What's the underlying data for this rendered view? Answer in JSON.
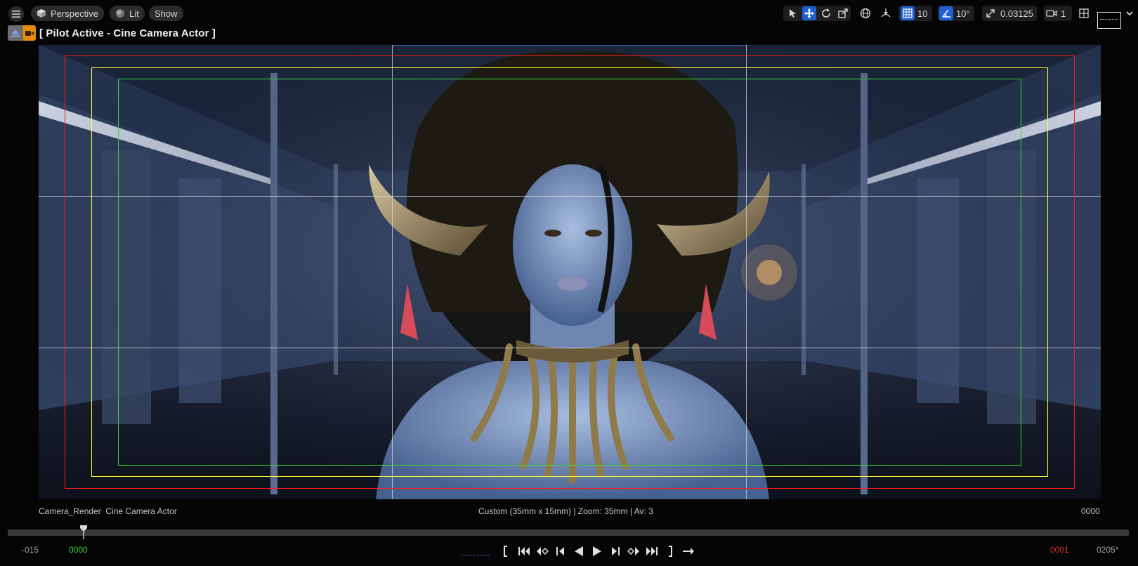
{
  "toolbar": {
    "viewport_type": "Perspective",
    "view_mode": "Lit",
    "show_label": "Show",
    "grid_snap_value": "10",
    "rotation_snap_value": "10°",
    "scale_snap_value": "0.03125",
    "camera_speed_value": "1",
    "accent_color": "#1f5fd1"
  },
  "pilot": {
    "label": "[ Pilot Active - Cine Camera Actor ]",
    "badge_color": "#e58c0c"
  },
  "overlays": {
    "outer_frame_color": "#ff1a1a",
    "action_safe_color": "#ffff33",
    "title_safe_color": "#33dd33"
  },
  "info": {
    "camera_name": "Camera_Render",
    "camera_type": "Cine Camera Actor",
    "filmback": "Custom (35mm x 15mm) | Zoom: 35mm | Av: 3",
    "current_frame": "0000"
  },
  "timeline": {
    "view_start": "-015",
    "playback_start": "0000",
    "playback_end": "0001",
    "view_end": "0205*",
    "start_color": "#3fcf3f",
    "end_color": "#e02a2a"
  }
}
